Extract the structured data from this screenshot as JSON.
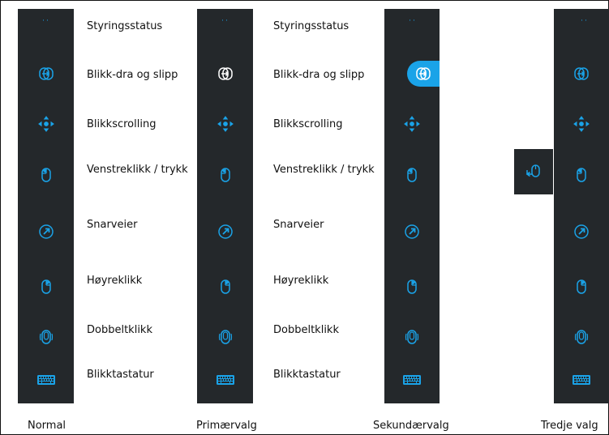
{
  "menu_items": [
    {
      "label": "Styringsstatus",
      "icon": "status-dots-icon"
    },
    {
      "label": "Blikk-dra og slipp",
      "icon": "drag-drop-icon"
    },
    {
      "label": "Blikkscrolling",
      "icon": "scroll-arrows-icon"
    },
    {
      "label": "Venstreklikk / trykk",
      "icon": "left-click-mouse-icon"
    },
    {
      "label": "Snarveier",
      "icon": "shortcut-arrow-icon"
    },
    {
      "label": "Høyreklikk",
      "icon": "right-click-mouse-icon"
    },
    {
      "label": "Dobbeltklikk",
      "icon": "double-click-mouse-icon"
    },
    {
      "label": "Blikktastatur",
      "icon": "keyboard-icon"
    }
  ],
  "captions": {
    "normal": "Normal",
    "primary": "Primærvalg",
    "secondary": "Sekundærvalg",
    "third": "Tredje valg"
  },
  "colors": {
    "accent": "#1aa3e8",
    "bar_background": "#24282b",
    "primary_icon": "#ffffff"
  }
}
